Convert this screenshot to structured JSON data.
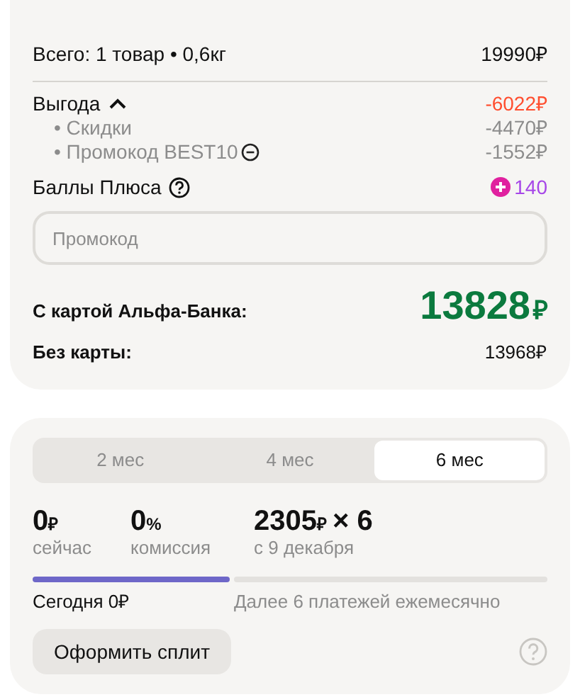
{
  "summary": {
    "total_label": "Всего: 1 товар • 0,6кг",
    "total_value": "19990₽",
    "benefit": {
      "label": "Выгода",
      "expanded": true,
      "value": "-6022₽",
      "items": [
        {
          "label": "• Скидки",
          "value": "-4470₽",
          "removable": false
        },
        {
          "label": "• Промокод BEST10",
          "value": "-1552₽",
          "removable": true
        }
      ]
    },
    "points": {
      "label": "Баллы Плюса",
      "value": "140"
    },
    "promo_field": {
      "placeholder": "Промокод"
    },
    "card_price": {
      "label": "С картой Альфа-Банка:",
      "value": "13828",
      "currency": "₽"
    },
    "no_card_price": {
      "label": "Без карты:",
      "value": "13968₽"
    }
  },
  "split": {
    "tabs": [
      {
        "label": "2 мес",
        "selected": false
      },
      {
        "label": "4 мес",
        "selected": false
      },
      {
        "label": "6 мес",
        "selected": true
      }
    ],
    "stats": [
      {
        "value": "0",
        "unit": "₽",
        "caption": "сейчас"
      },
      {
        "value": "0",
        "unit": "%",
        "caption": "комиссия"
      },
      {
        "value": "2305",
        "unit": "₽",
        "suffix": "× 6",
        "caption": "с 9 декабря"
      }
    ],
    "timeline": [
      {
        "label": "Сегодня 0₽",
        "active": true
      },
      {
        "label": "Далее 6 платежей ежемесячно",
        "active": false
      }
    ],
    "button": "Оформить сплит"
  }
}
